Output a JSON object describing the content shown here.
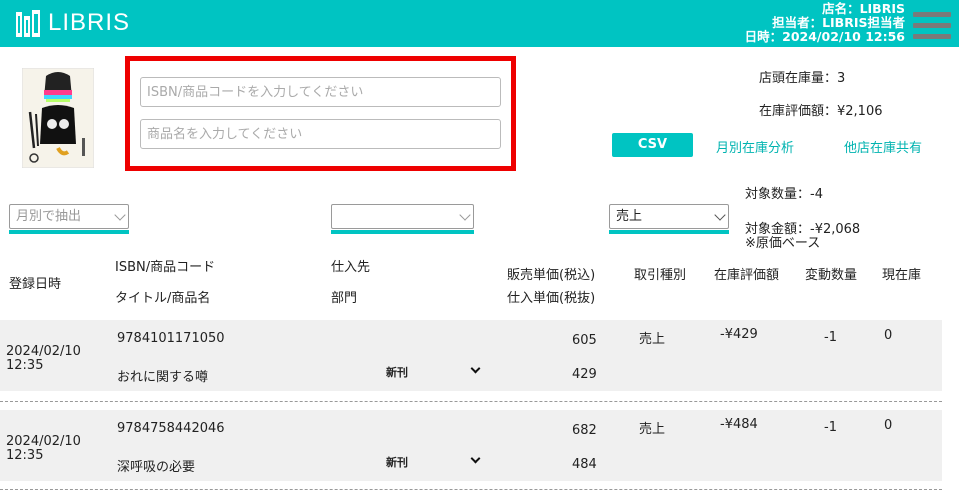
{
  "header": {
    "brand": "LIBRIS",
    "store_line": "店名：LIBRIS",
    "staff_line": "担当者：LIBRIS担当者",
    "datetime_line": "日時：2024/02/10  12:56"
  },
  "search": {
    "isbn_placeholder": "ISBN/商品コードを入力してください",
    "title_placeholder": "商品名を入力してください"
  },
  "stock": {
    "qty_line": "店頭在庫量：3",
    "value_line": "在庫評価額：¥2,106"
  },
  "actions": {
    "csv_label": "CSV",
    "monthly_link": "月別在庫分析",
    "other_store_link": "他店在庫共有"
  },
  "filters": {
    "month_placeholder": "月別で抽出",
    "supplier_value": "",
    "type_value": "売上"
  },
  "summary": {
    "count_line": "対象数量：-4",
    "amount_line": "対象金額：-¥2,068",
    "note_line": "※原価ベース"
  },
  "columns": {
    "registered": "登録日時",
    "isbn": "ISBN/商品コード",
    "title": "タイトル/商品名",
    "supplier": "仕入先",
    "dept": "部門",
    "sell_price": "販売単価(税込)",
    "cost_price": "仕入単価(税抜)",
    "txn_type": "取引種別",
    "stock_value": "在庫評価額",
    "change_qty": "変動数量",
    "current_stock": "現在庫"
  },
  "rows": [
    {
      "date": "2024/02/10",
      "time": "12:35",
      "isbn": "9784101171050",
      "title": "おれに関する噂",
      "dept": "新刊",
      "sell_price": "605",
      "cost_price": "429",
      "txn_type": "売上",
      "stock_value": "-¥429",
      "change_qty": "-1",
      "current_stock": "0"
    },
    {
      "date": "2024/02/10",
      "time": "12:35",
      "isbn": "9784758442046",
      "title": "深呼吸の必要",
      "dept": "新刊",
      "sell_price": "682",
      "cost_price": "484",
      "txn_type": "売上",
      "stock_value": "-¥484",
      "change_qty": "-1",
      "current_stock": "0"
    }
  ],
  "colors": {
    "accent": "#00c4c2",
    "highlight_border": "#ee0000",
    "row_bg": "#f0f0f0"
  }
}
